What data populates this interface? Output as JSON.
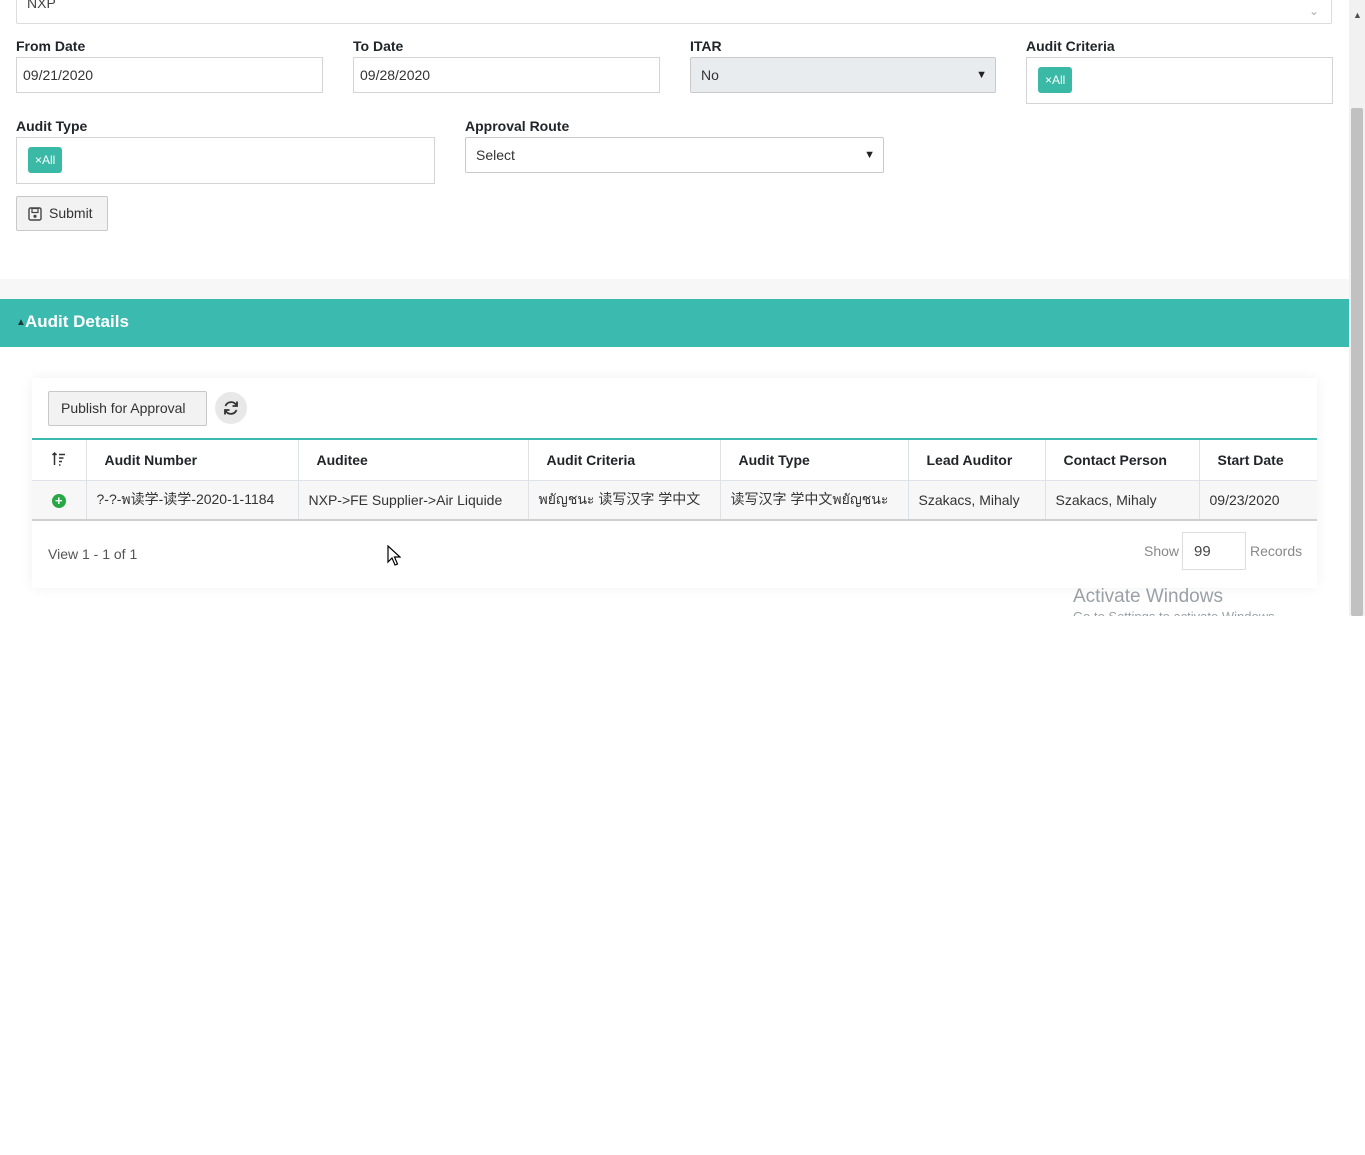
{
  "top_select": {
    "value": "NXP"
  },
  "filters": {
    "from_date": {
      "label": "From Date",
      "value": "09/21/2020"
    },
    "to_date": {
      "label": "To Date",
      "value": "09/28/2020"
    },
    "itar": {
      "label": "ITAR",
      "value": "No"
    },
    "audit_criteria": {
      "label": "Audit Criteria",
      "tag": "All"
    },
    "audit_type": {
      "label": "Audit Type",
      "tag": "All"
    },
    "approval_route": {
      "label": "Approval Route",
      "value": "Select"
    },
    "submit_label": "Submit"
  },
  "panel": {
    "title": "Audit Details"
  },
  "toolbar": {
    "publish_label": "Publish for Approval"
  },
  "table": {
    "headers": [
      "Audit Number",
      "Auditee",
      "Audit Criteria",
      "Audit Type",
      "Lead Auditor",
      "Contact Person",
      "Start Date"
    ],
    "rows": [
      {
        "audit_number": "?-?-พ读学-读学-2020-1-1184",
        "auditee": "NXP->FE Supplier->Air Liquide",
        "audit_criteria": "พยัญชนะ 读写汉字 学中文",
        "audit_type": "读写汉字 学中文พยัญชนะ",
        "lead_auditor": "Szakacs, Mihaly",
        "contact_person": "Szakacs, Mihaly",
        "start_date": "09/23/2020"
      }
    ]
  },
  "pager": {
    "view_text": "View 1 - 1 of 1",
    "show_label": "Show",
    "records_value": "99",
    "records_label": "Records"
  },
  "watermark": {
    "line1": "Activate Windows",
    "line2": "Go to Settings to activate Windows."
  },
  "colors": {
    "accent": "#3bbaaf",
    "tag": "#3bb9a7",
    "add_icon": "#28a745"
  }
}
